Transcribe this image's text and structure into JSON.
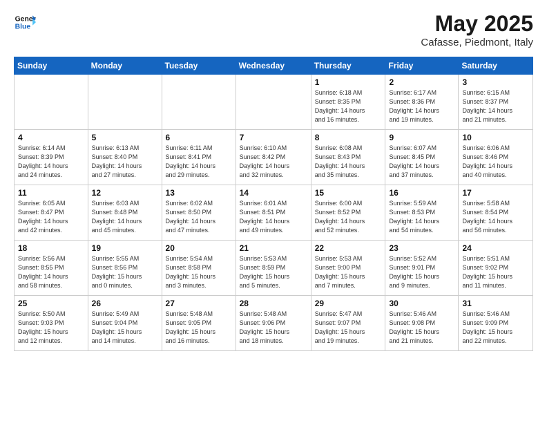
{
  "logo": {
    "line1": "General",
    "line2": "Blue"
  },
  "title": "May 2025",
  "subtitle": "Cafasse, Piedmont, Italy",
  "weekdays": [
    "Sunday",
    "Monday",
    "Tuesday",
    "Wednesday",
    "Thursday",
    "Friday",
    "Saturday"
  ],
  "weeks": [
    [
      {
        "day": "",
        "info": ""
      },
      {
        "day": "",
        "info": ""
      },
      {
        "day": "",
        "info": ""
      },
      {
        "day": "",
        "info": ""
      },
      {
        "day": "1",
        "info": "Sunrise: 6:18 AM\nSunset: 8:35 PM\nDaylight: 14 hours\nand 16 minutes."
      },
      {
        "day": "2",
        "info": "Sunrise: 6:17 AM\nSunset: 8:36 PM\nDaylight: 14 hours\nand 19 minutes."
      },
      {
        "day": "3",
        "info": "Sunrise: 6:15 AM\nSunset: 8:37 PM\nDaylight: 14 hours\nand 21 minutes."
      }
    ],
    [
      {
        "day": "4",
        "info": "Sunrise: 6:14 AM\nSunset: 8:39 PM\nDaylight: 14 hours\nand 24 minutes."
      },
      {
        "day": "5",
        "info": "Sunrise: 6:13 AM\nSunset: 8:40 PM\nDaylight: 14 hours\nand 27 minutes."
      },
      {
        "day": "6",
        "info": "Sunrise: 6:11 AM\nSunset: 8:41 PM\nDaylight: 14 hours\nand 29 minutes."
      },
      {
        "day": "7",
        "info": "Sunrise: 6:10 AM\nSunset: 8:42 PM\nDaylight: 14 hours\nand 32 minutes."
      },
      {
        "day": "8",
        "info": "Sunrise: 6:08 AM\nSunset: 8:43 PM\nDaylight: 14 hours\nand 35 minutes."
      },
      {
        "day": "9",
        "info": "Sunrise: 6:07 AM\nSunset: 8:45 PM\nDaylight: 14 hours\nand 37 minutes."
      },
      {
        "day": "10",
        "info": "Sunrise: 6:06 AM\nSunset: 8:46 PM\nDaylight: 14 hours\nand 40 minutes."
      }
    ],
    [
      {
        "day": "11",
        "info": "Sunrise: 6:05 AM\nSunset: 8:47 PM\nDaylight: 14 hours\nand 42 minutes."
      },
      {
        "day": "12",
        "info": "Sunrise: 6:03 AM\nSunset: 8:48 PM\nDaylight: 14 hours\nand 45 minutes."
      },
      {
        "day": "13",
        "info": "Sunrise: 6:02 AM\nSunset: 8:50 PM\nDaylight: 14 hours\nand 47 minutes."
      },
      {
        "day": "14",
        "info": "Sunrise: 6:01 AM\nSunset: 8:51 PM\nDaylight: 14 hours\nand 49 minutes."
      },
      {
        "day": "15",
        "info": "Sunrise: 6:00 AM\nSunset: 8:52 PM\nDaylight: 14 hours\nand 52 minutes."
      },
      {
        "day": "16",
        "info": "Sunrise: 5:59 AM\nSunset: 8:53 PM\nDaylight: 14 hours\nand 54 minutes."
      },
      {
        "day": "17",
        "info": "Sunrise: 5:58 AM\nSunset: 8:54 PM\nDaylight: 14 hours\nand 56 minutes."
      }
    ],
    [
      {
        "day": "18",
        "info": "Sunrise: 5:56 AM\nSunset: 8:55 PM\nDaylight: 14 hours\nand 58 minutes."
      },
      {
        "day": "19",
        "info": "Sunrise: 5:55 AM\nSunset: 8:56 PM\nDaylight: 15 hours\nand 0 minutes."
      },
      {
        "day": "20",
        "info": "Sunrise: 5:54 AM\nSunset: 8:58 PM\nDaylight: 15 hours\nand 3 minutes."
      },
      {
        "day": "21",
        "info": "Sunrise: 5:53 AM\nSunset: 8:59 PM\nDaylight: 15 hours\nand 5 minutes."
      },
      {
        "day": "22",
        "info": "Sunrise: 5:53 AM\nSunset: 9:00 PM\nDaylight: 15 hours\nand 7 minutes."
      },
      {
        "day": "23",
        "info": "Sunrise: 5:52 AM\nSunset: 9:01 PM\nDaylight: 15 hours\nand 9 minutes."
      },
      {
        "day": "24",
        "info": "Sunrise: 5:51 AM\nSunset: 9:02 PM\nDaylight: 15 hours\nand 11 minutes."
      }
    ],
    [
      {
        "day": "25",
        "info": "Sunrise: 5:50 AM\nSunset: 9:03 PM\nDaylight: 15 hours\nand 12 minutes."
      },
      {
        "day": "26",
        "info": "Sunrise: 5:49 AM\nSunset: 9:04 PM\nDaylight: 15 hours\nand 14 minutes."
      },
      {
        "day": "27",
        "info": "Sunrise: 5:48 AM\nSunset: 9:05 PM\nDaylight: 15 hours\nand 16 minutes."
      },
      {
        "day": "28",
        "info": "Sunrise: 5:48 AM\nSunset: 9:06 PM\nDaylight: 15 hours\nand 18 minutes."
      },
      {
        "day": "29",
        "info": "Sunrise: 5:47 AM\nSunset: 9:07 PM\nDaylight: 15 hours\nand 19 minutes."
      },
      {
        "day": "30",
        "info": "Sunrise: 5:46 AM\nSunset: 9:08 PM\nDaylight: 15 hours\nand 21 minutes."
      },
      {
        "day": "31",
        "info": "Sunrise: 5:46 AM\nSunset: 9:09 PM\nDaylight: 15 hours\nand 22 minutes."
      }
    ]
  ]
}
